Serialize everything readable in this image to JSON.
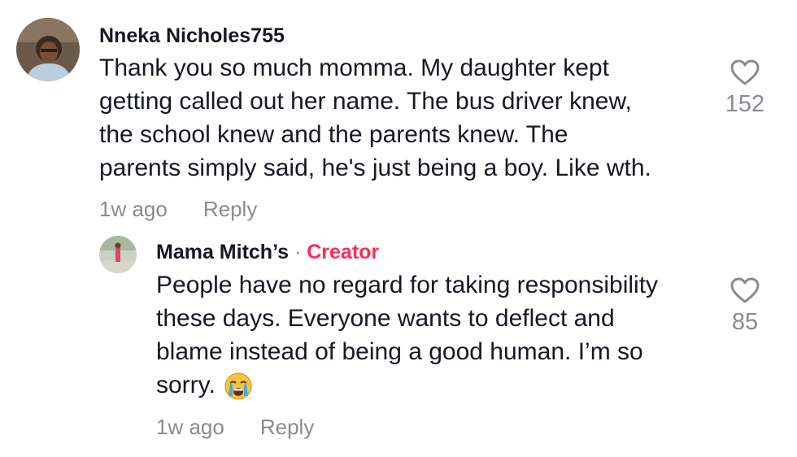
{
  "comments": [
    {
      "username": "Nneka Nicholes755",
      "text_lines": [
        "Thank you so much momma. My daughter kept",
        "getting called out her name. The bus driver knew,",
        "the school knew and the parents knew. The",
        "parents simply said, he's just being a boy. Like wth."
      ],
      "time": "1w ago",
      "reply_label": "Reply",
      "like_count": "152"
    },
    {
      "username": "Mama Mitch’s",
      "separator": "·",
      "creator_label": "Creator",
      "text_lines": [
        "People have no regard for taking responsibility",
        "these days. Everyone wants to deflect and",
        "blame instead of being a good human. I’m so",
        "sorry."
      ],
      "emoji": "loudly-crying-face-icon",
      "time": "1w ago",
      "reply_label": "Reply",
      "like_count": "85"
    }
  ]
}
